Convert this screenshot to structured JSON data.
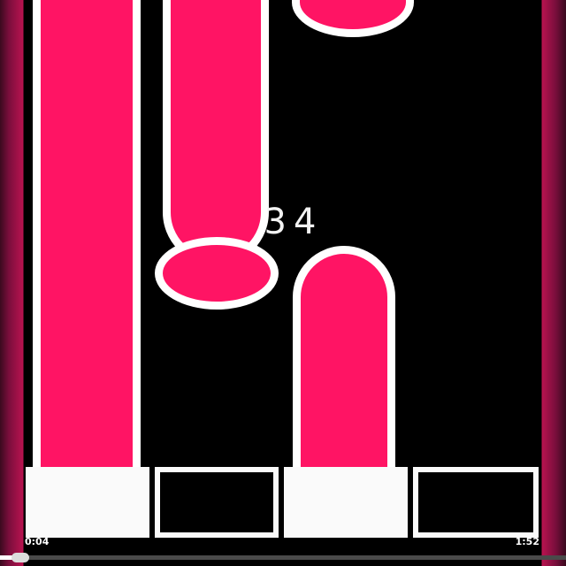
{
  "game": {
    "score": "34",
    "colors": {
      "tile": "#ff1464",
      "outline": "#ffffff",
      "background": "#000000"
    },
    "lanes": [
      {
        "lane": 1,
        "tile": "long-hold"
      },
      {
        "lane": 2,
        "tile": "long-hold"
      },
      {
        "lane": 3,
        "tile": "short"
      },
      {
        "lane": 4,
        "tile": "none"
      }
    ],
    "hit_keys": [
      {
        "lane": 1,
        "state": "pressed"
      },
      {
        "lane": 2,
        "state": "idle"
      },
      {
        "lane": 3,
        "state": "pressed"
      },
      {
        "lane": 4,
        "state": "idle"
      }
    ]
  },
  "video": {
    "current_time": "0:04",
    "total_time": "1:52",
    "progress": 0.036
  }
}
